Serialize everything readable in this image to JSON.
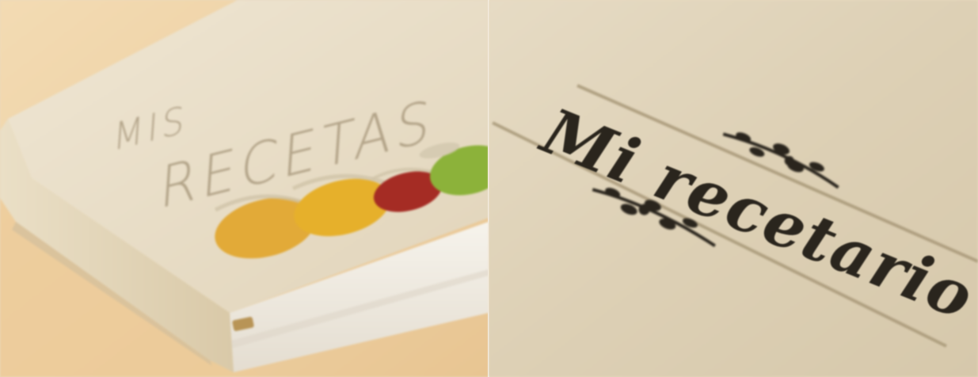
{
  "left_photo": {
    "subject": "cookbook-hardcover",
    "cover_text_line1": "MIS",
    "cover_text_line2": "RECETAS",
    "jar_colors": [
      "#e2aa38",
      "#e6b02b",
      "#a52c24",
      "#8cb23a"
    ],
    "colors": {
      "table": "#efcf9e",
      "cover": "#e9deca",
      "pages": "#f2eee6"
    }
  },
  "right_photo": {
    "subject": "engraved-cover-closeup",
    "engraved_title": "Mi recetario",
    "colors": {
      "surface": "#ddd0b6",
      "engraving": "#2a251d",
      "line": "#a89878"
    }
  }
}
